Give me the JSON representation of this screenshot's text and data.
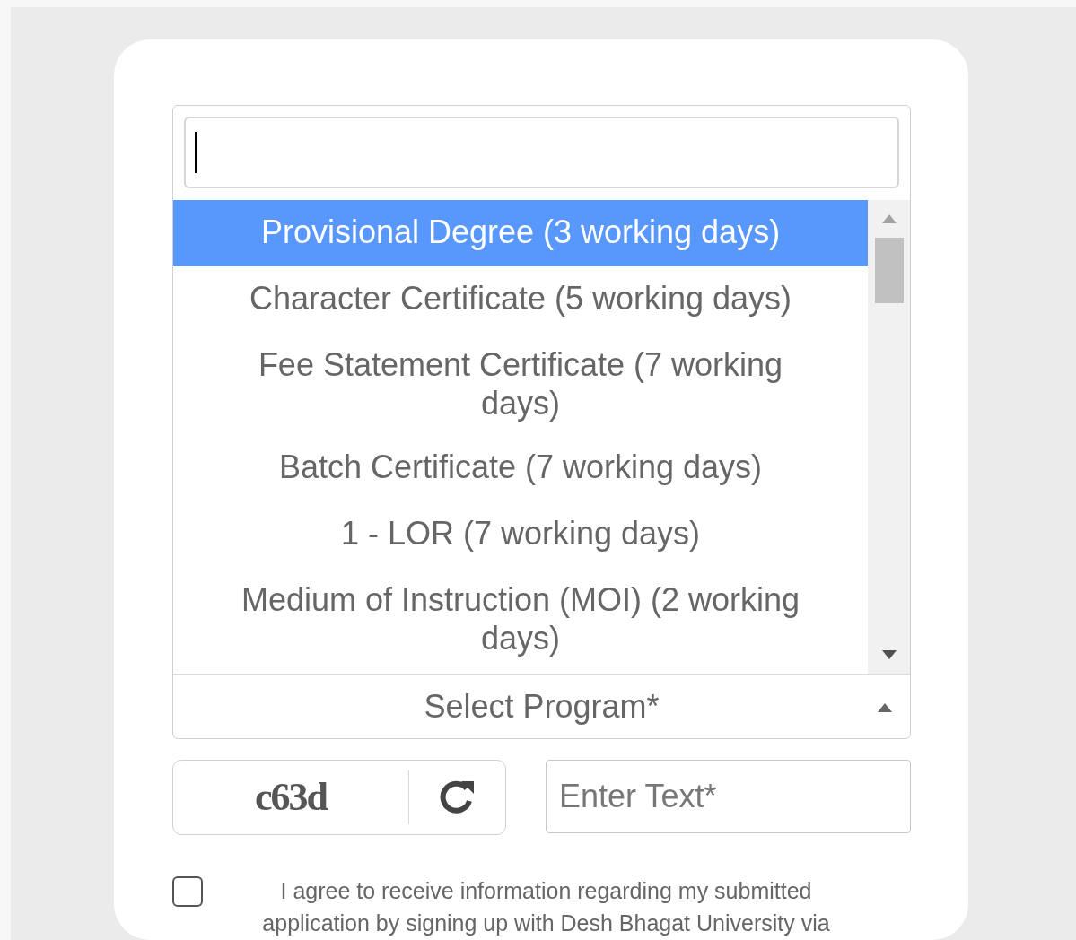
{
  "program_select": {
    "placeholder": "Select Program*",
    "expanded": true,
    "options": [
      {
        "label": "Provisional Degree (3 working days)",
        "selected": true
      },
      {
        "label": "Character Certificate (5 working days)",
        "selected": false
      },
      {
        "label": "Fee Statement Certificate (7 working days)",
        "selected": false
      },
      {
        "label": "Batch Certificate (7 working days)",
        "selected": false
      },
      {
        "label": "1 - LOR (7 working days)",
        "selected": false
      },
      {
        "label": "Medium of Instruction (MOI) (2 working days)",
        "selected": false
      }
    ]
  },
  "captcha": {
    "code": "c63d"
  },
  "captcha_input": {
    "placeholder": "Enter Text*"
  },
  "consent": {
    "checked": false,
    "text": "I agree to receive information regarding my submitted application by signing up with Desh Bhagat University via"
  }
}
